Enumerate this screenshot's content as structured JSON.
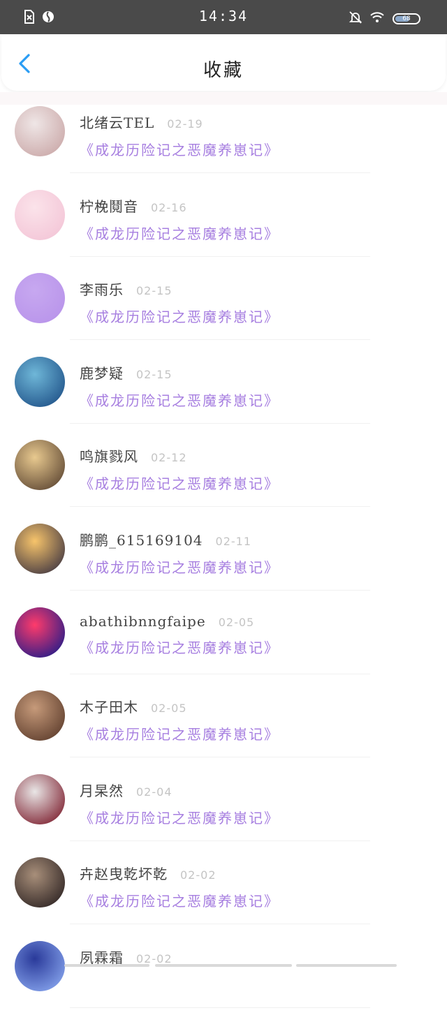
{
  "status_bar": {
    "time": "14:34",
    "battery": "68"
  },
  "header": {
    "title": "收藏"
  },
  "favorites": [
    {
      "user": "北绪云TEL",
      "date": "02-19",
      "work": "《成龙历险记之恶魔养崽记》",
      "avatar_colors": [
        "#efe6e6",
        "#c9a6a6"
      ]
    },
    {
      "user": "柠梚鬩音",
      "date": "02-16",
      "work": "《成龙历险记之恶魔养崽记》",
      "avatar_colors": [
        "#fbe3ea",
        "#f3c4d6"
      ]
    },
    {
      "user": "李雨乐",
      "date": "02-15",
      "work": "《成龙历险记之恶魔养崽记》",
      "avatar_colors": [
        "#c7a8f0",
        "#b893ea"
      ]
    },
    {
      "user": "鹿梦疑",
      "date": "02-15",
      "work": "《成龙历险记之恶魔养崽记》",
      "avatar_colors": [
        "#6fb7d8",
        "#1d4f86"
      ]
    },
    {
      "user": "鸣旗戮风",
      "date": "02-12",
      "work": "《成龙历险记之恶魔养崽记》",
      "avatar_colors": [
        "#e8c98f",
        "#5a4330"
      ]
    },
    {
      "user": "鹏鹏_615169104",
      "date": "02-11",
      "work": "《成龙历险记之恶魔养崽记》",
      "avatar_colors": [
        "#f7c46b",
        "#3b3240"
      ]
    },
    {
      "user": "abathibnngfaipe",
      "date": "02-05",
      "work": "《成龙历险记之恶魔养崽记》",
      "avatar_colors": [
        "#ff3b6b",
        "#1a1a8a"
      ]
    },
    {
      "user": "木子田木",
      "date": "02-05",
      "work": "《成龙历险记之恶魔养崽记》",
      "avatar_colors": [
        "#c69a7a",
        "#5a3a2a"
      ]
    },
    {
      "user": "月杲然",
      "date": "02-04",
      "work": "《成龙历险记之恶魔养崽记》",
      "avatar_colors": [
        "#e9e6e6",
        "#7a1a2a"
      ]
    },
    {
      "user": "卉赵曳乾坏乾",
      "date": "02-02",
      "work": "《成龙历险记之恶魔养崽记》",
      "avatar_colors": [
        "#a88f7a",
        "#2a2020"
      ]
    },
    {
      "user": "夙霖霜",
      "date": "02-02",
      "work": "",
      "avatar_colors": [
        "#2a3a9a",
        "#8aa8f0"
      ]
    }
  ]
}
